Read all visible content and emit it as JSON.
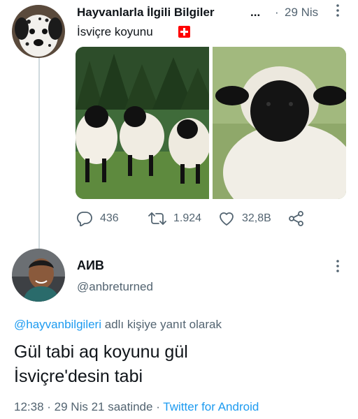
{
  "tweet": {
    "author_name": "Hayvanlarla İlgili Bilgiler",
    "ellipsis": "...",
    "separator": "·",
    "date": "29 Nis",
    "text": "İsviçre koyunu",
    "flag_icon": "swiss-flag-icon",
    "stats": {
      "replies": "436",
      "retweets": "1.924",
      "likes": "32,8B"
    }
  },
  "reply": {
    "author_name": "АИВ",
    "handle": "@anbreturned",
    "reply_to_mention": "@hayvanbilgileri",
    "reply_to_suffix": " adlı kişiye yanıt olarak",
    "body_line1": "Gül tabi aq koyunu gül",
    "body_line2": "İsviçre'desin tabi",
    "time": "12:38",
    "separator": " · ",
    "date": "29 Nis 21 saatinde",
    "client": "Twitter for Android"
  },
  "colors": {
    "accent": "#1d9bf0",
    "secondary_text": "#536471",
    "primary_text": "#0f1419",
    "flag_red": "#ff0000"
  }
}
